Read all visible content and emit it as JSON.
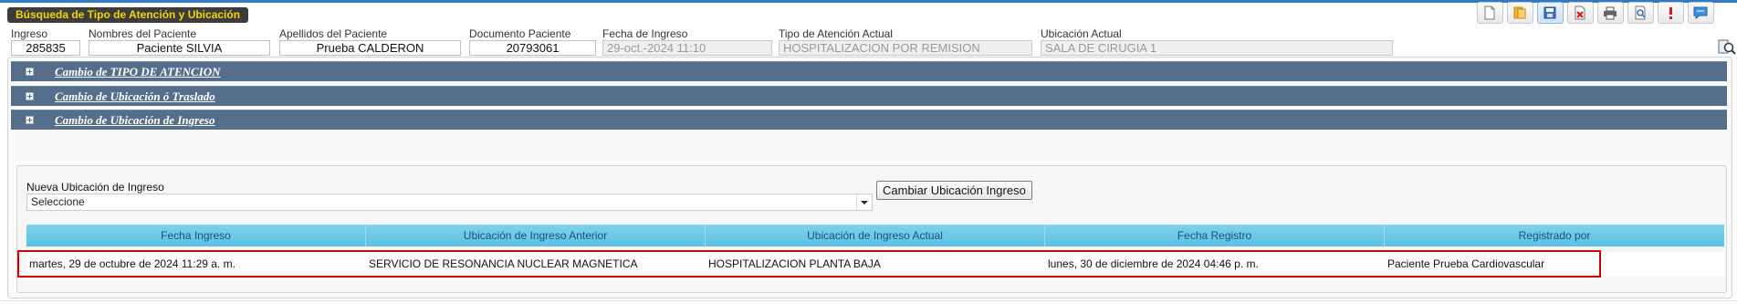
{
  "page_title": "Búsqueda de Tipo de Atención y Ubicación",
  "toolbar": {
    "buttons": [
      {
        "icon": "new-document-icon"
      },
      {
        "icon": "open-folder-icon"
      },
      {
        "icon": "save-icon"
      },
      {
        "icon": "delete-icon"
      },
      {
        "icon": "print-icon"
      },
      {
        "icon": "preview-icon"
      },
      {
        "icon": "alert-icon"
      },
      {
        "icon": "help-chat-icon"
      }
    ]
  },
  "patient_fields": {
    "ingreso_label": "Ingreso",
    "ingreso_value": "285835",
    "nombres_label": "Nombres del Paciente",
    "nombres_value": "Paciente SILVIA",
    "apellidos_label": "Apellidos del Paciente",
    "apellidos_value": "Prueba CALDERON",
    "documento_label": "Documento Paciente",
    "documento_value": "20793061",
    "fecha_ingreso_label": "Fecha de Ingreso",
    "fecha_ingreso_value": "29-oct.-2024 11:10",
    "tipo_atencion_label": "Tipo de Atención Actual",
    "tipo_atencion_value": "HOSPITALIZACION POR REMISION",
    "ubicacion_label": "Ubicación Actual",
    "ubicacion_value": "SALA DE CIRUGIA 1"
  },
  "accordion": [
    {
      "title": "Cambio de TIPO DE ATENCION"
    },
    {
      "title": "Cambio de Ubicación ó Traslado"
    },
    {
      "title": "Cambio de Ubicación de Ingreso"
    }
  ],
  "ingreso_panel": {
    "select_label": "Nueva Ubicación de Ingreso",
    "select_value": "Seleccione",
    "action_button": "Cambiar Ubicación Ingreso"
  },
  "grid": {
    "columns": [
      "Fecha Ingreso",
      "Ubicación de Ingreso Anterior",
      "Ubicación de Ingreso Actual",
      "Fecha Registro",
      "Registrado por"
    ],
    "rows": [
      [
        "martes, 29 de octubre de 2024 11:29 a. m.",
        "SERVICIO DE RESONANCIA NUCLEAR MAGNETICA",
        "HOSPITALIZACION PLANTA BAJA",
        "lunes, 30 de diciembre de 2024 04:46 p. m.",
        "Paciente Prueba Cardiovascular"
      ]
    ]
  },
  "colors": {
    "accordion_bg": "#546e8b",
    "grid_header_bg": "#5cc0e1",
    "highlight_border": "#d10000",
    "title_text": "#f2d600"
  }
}
